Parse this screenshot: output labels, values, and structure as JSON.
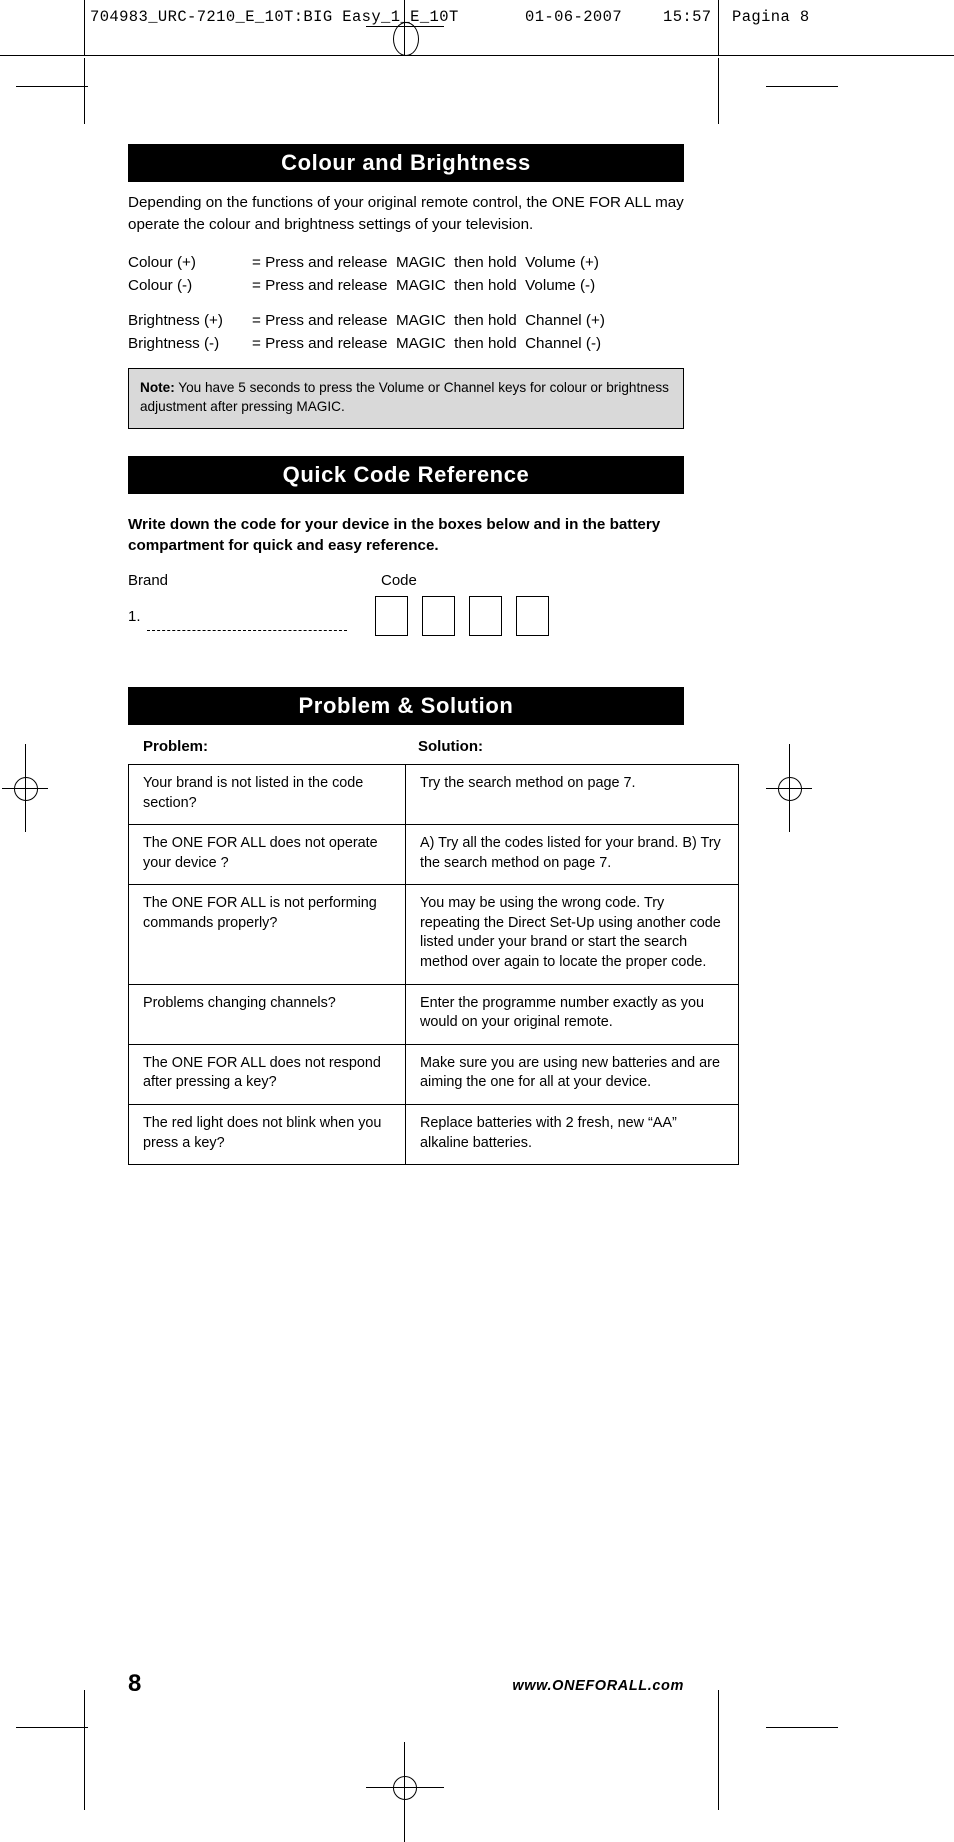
{
  "prepress": {
    "job": "704983_URC-7210_E_10T:BIG Easy_1_E_10T",
    "date": "01-06-2007",
    "time": "15:57",
    "page_label": "Pagina 8"
  },
  "sections": {
    "colour_brightness": {
      "title": "Colour and Brightness",
      "intro": "Depending on the functions of your original remote control, the ONE FOR ALL may operate the colour and brightness settings of your television.",
      "definitions": [
        {
          "label": "Colour (+)",
          "value": "= Press and release  MAGIC  then hold  Volume (+)"
        },
        {
          "label": "Colour (-)",
          "value": "= Press and release  MAGIC  then hold  Volume (-)"
        },
        {
          "label": "Brightness (+)",
          "value": "= Press and release  MAGIC  then hold  Channel (+)"
        },
        {
          "label": "Brightness (-)",
          "value": "= Press and release  MAGIC  then hold  Channel (-)"
        }
      ],
      "note_label": "Note:",
      "note_text": " You have 5 seconds to press the Volume or Channel keys for colour or brightness adjustment after pressing MAGIC."
    },
    "quick_code": {
      "title": "Quick Code Reference",
      "lead": "Write down the code for your device in the boxes below and in the battery compartment for quick and easy reference.",
      "brand_label": "Brand",
      "code_label": "Code",
      "entry_number": "1.",
      "brand_value": "",
      "code_digits": [
        "",
        "",
        "",
        ""
      ]
    },
    "problem_solution": {
      "title": "Problem & Solution",
      "columns": [
        "Problem:",
        "Solution:"
      ],
      "rows": [
        {
          "problem": "Your brand is not listed in the code section?",
          "solution": "Try the search method on page 7."
        },
        {
          "problem": "The ONE FOR ALL does not operate your device ?",
          "solution": "A) Try all the codes listed for your brand. B) Try the search method on page 7."
        },
        {
          "problem": "The ONE FOR ALL is not performing commands properly?",
          "solution": "You may be using the wrong code. Try repeating the Direct Set-Up using another code listed under your brand or start the search method over again to locate the proper code."
        },
        {
          "problem": "Problems changing channels?",
          "solution": "Enter the programme number exactly as you would on your original remote."
        },
        {
          "problem": "The ONE FOR ALL does not respond after pressing a key?",
          "solution": "Make sure you are using new batteries and are aiming the one for all at your device."
        },
        {
          "problem": "The red light does not blink when you press a key?",
          "solution": "Replace batteries with 2 fresh, new “AA” alkaline batteries."
        }
      ]
    }
  },
  "footer": {
    "page_number": "8",
    "website": "www.ONEFORALL.com"
  },
  "colors": {
    "bar_background": "#000000",
    "bar_text": "#ffffff",
    "note_background": "#d9d9d9",
    "rule": "#000000"
  }
}
